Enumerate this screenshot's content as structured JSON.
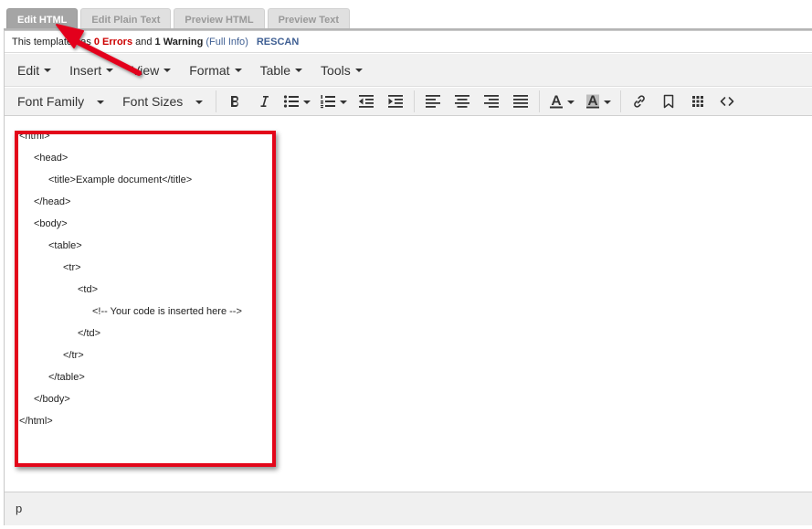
{
  "tabs": [
    {
      "label": "Edit HTML",
      "active": true
    },
    {
      "label": "Edit Plain Text",
      "active": false
    },
    {
      "label": "Preview HTML",
      "active": false
    },
    {
      "label": "Preview Text",
      "active": false
    }
  ],
  "scan_status": {
    "prefix": "This template has ",
    "errors": "0 Errors",
    "middle": " and ",
    "warnings": "1 Warning",
    "open_paren": " (",
    "full_info": "Full Info",
    "close_paren": ")",
    "rescan": "RESCAN"
  },
  "menubar": {
    "items": [
      {
        "label": "Edit"
      },
      {
        "label": "Insert"
      },
      {
        "label": "View"
      },
      {
        "label": "Format"
      },
      {
        "label": "Table"
      },
      {
        "label": "Tools"
      }
    ]
  },
  "toolbar": {
    "font_family": "Font Family",
    "font_sizes": "Font Sizes",
    "buttons": [
      "bold-icon",
      "italic-icon",
      "bullet-list-icon",
      "numbered-list-icon",
      "outdent-icon",
      "indent-icon",
      "align-left-icon",
      "align-center-icon",
      "align-right-icon",
      "justify-icon",
      "text-color-icon",
      "background-color-icon",
      "link-icon",
      "bookmark-icon",
      "table-grid-icon",
      "source-code-icon"
    ]
  },
  "code_lines": [
    {
      "text": "<html>",
      "indent": 0
    },
    {
      "text": "<head>",
      "indent": 1
    },
    {
      "text": "<title>Example document</title>",
      "indent": 2
    },
    {
      "text": "</head>",
      "indent": 1
    },
    {
      "text": "<body>",
      "indent": 1
    },
    {
      "text": "<table>",
      "indent": 2
    },
    {
      "text": "<tr>",
      "indent": 3
    },
    {
      "text": "<td>",
      "indent": 4
    },
    {
      "text": "<!-- Your code is inserted here -->",
      "indent": 5
    },
    {
      "text": "</td>",
      "indent": 4
    },
    {
      "text": "</tr>",
      "indent": 3
    },
    {
      "text": "</table>",
      "indent": 2
    },
    {
      "text": "</body>",
      "indent": 1
    },
    {
      "text": "</html>",
      "indent": 0
    }
  ],
  "status_bar": {
    "path": "p"
  },
  "colors": {
    "highlight": "#e3061a",
    "error_text": "#cc0000",
    "link_text": "#3f5f93",
    "active_tab": "#a5a5a5",
    "toolbar_bg": "#f1f1f1"
  }
}
